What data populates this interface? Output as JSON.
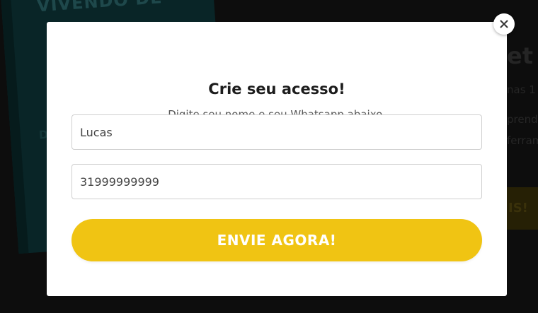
{
  "background": {
    "book_title": "VIVENDO DE",
    "book_subtitle": "D",
    "heading_fragment": "et",
    "line_1": "nas 1",
    "line_2": "prend",
    "line_3": "ferram",
    "cta_fragment": "IS!"
  },
  "modal": {
    "title": "Crie seu acesso!",
    "subtitle": "Digite seu nome e seu Whatsapp abaixo.",
    "name_field": {
      "value": "Lucas",
      "placeholder": ""
    },
    "phone_field": {
      "value": "31999999999",
      "placeholder": ""
    },
    "submit_label": "ENVIE AGORA!",
    "close_icon": "close-icon"
  },
  "colors": {
    "accent": "#f0c413",
    "modal_bg": "#ffffff",
    "title_text": "#1c1c1c"
  }
}
